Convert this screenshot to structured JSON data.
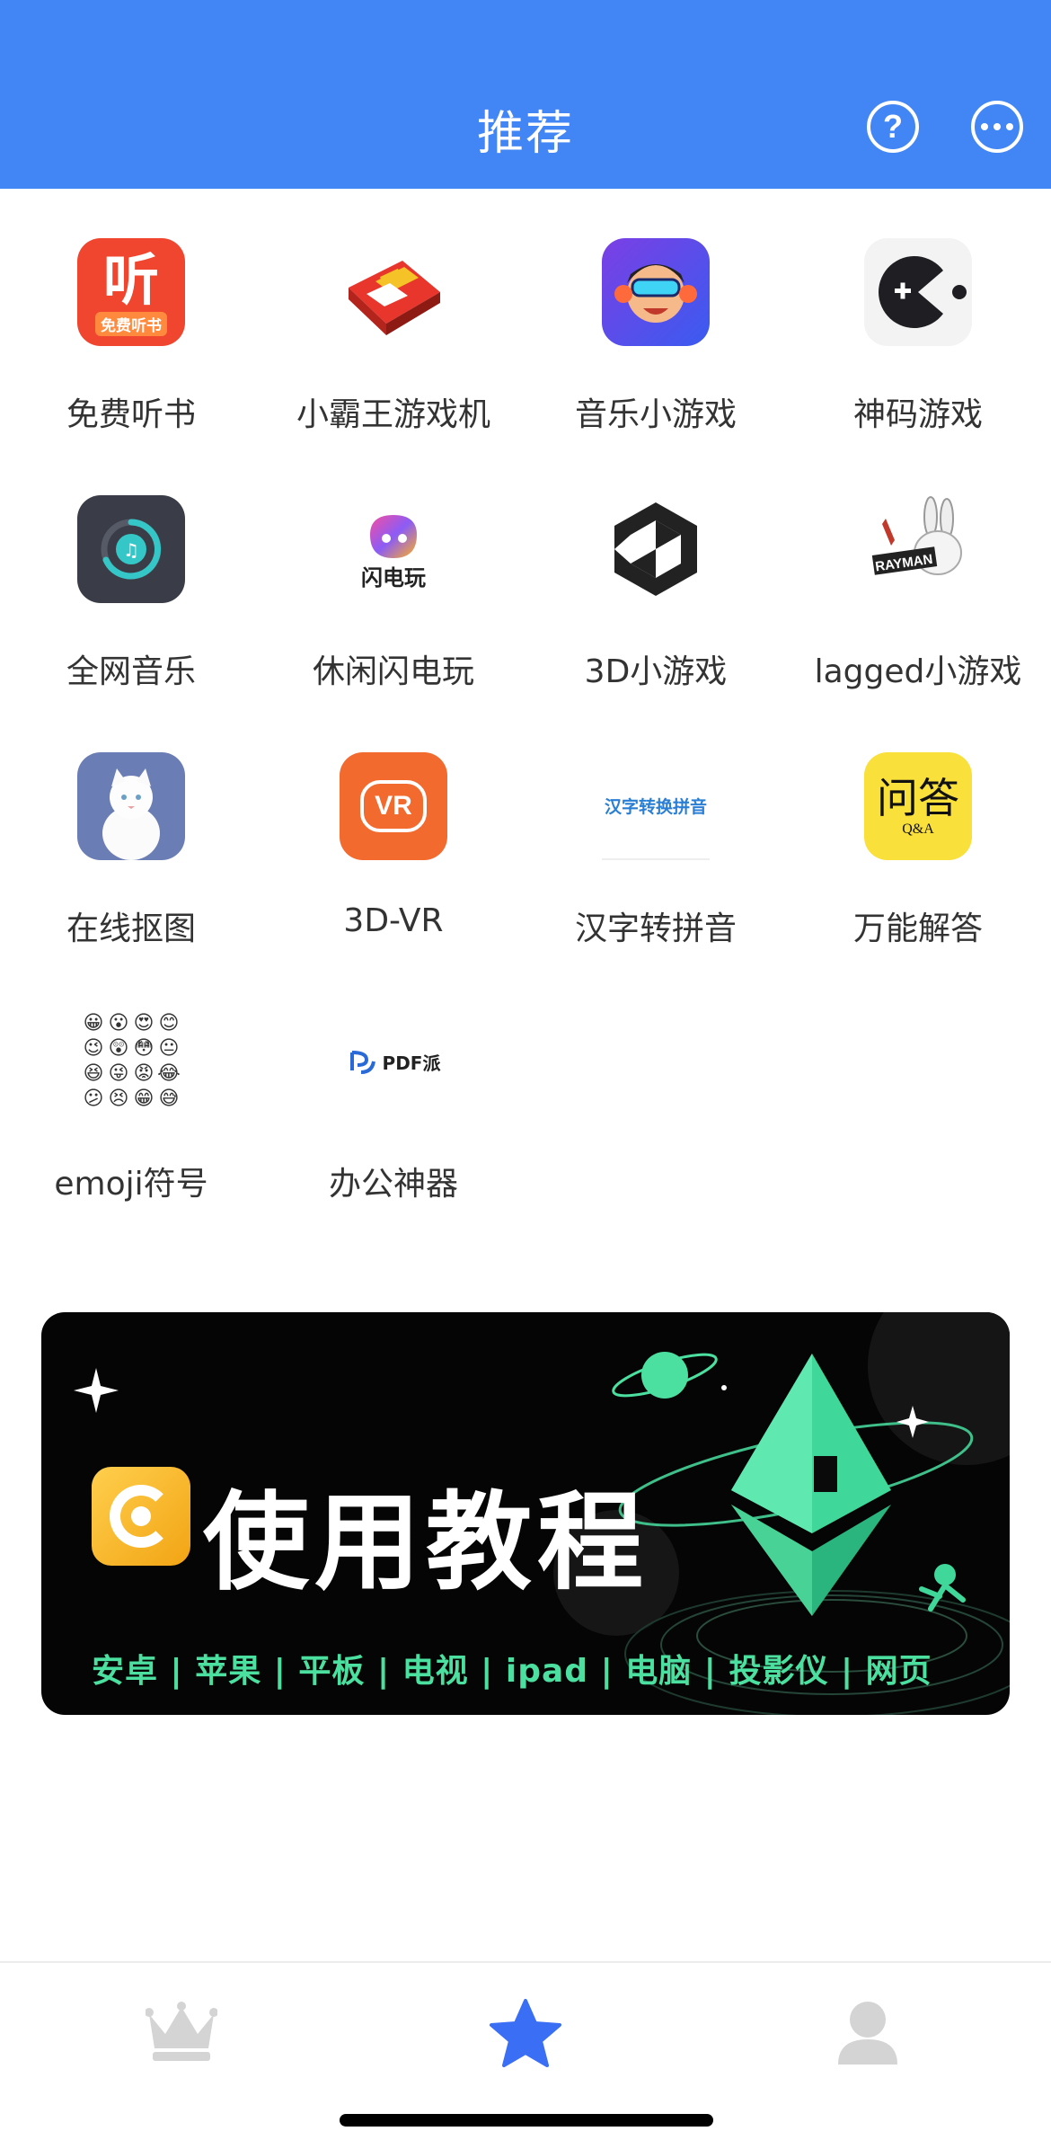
{
  "header": {
    "title": "推荐",
    "help_icon": "question-circle-icon",
    "chat_icon": "chat-bubble-icon",
    "background": "#4285f4"
  },
  "apps": [
    {
      "label": "免费听书",
      "icon": "listen-book-icon",
      "icon_text": "听",
      "icon_subtext": "免费听书"
    },
    {
      "label": "小霸王游戏机",
      "icon": "game-console-icon"
    },
    {
      "label": "音乐小游戏",
      "icon": "music-game-icon"
    },
    {
      "label": "神码游戏",
      "icon": "pacman-icon"
    },
    {
      "label": "全网音乐",
      "icon": "music-player-icon"
    },
    {
      "label": "休闲闪电玩",
      "icon": "flash-play-icon",
      "icon_text": "闪电玩"
    },
    {
      "label": "3D小游戏",
      "icon": "unity-icon"
    },
    {
      "label": "lagged小游戏",
      "icon": "rabbid-icon"
    },
    {
      "label": "在线抠图",
      "icon": "cat-photo-icon"
    },
    {
      "label": "3D-VR",
      "icon": "vr-icon",
      "icon_text": "VR"
    },
    {
      "label": "汉字转拼音",
      "icon": "pinyin-icon",
      "icon_text": "汉字转换拼音"
    },
    {
      "label": "万能解答",
      "icon": "qa-icon",
      "icon_text": "问答",
      "icon_subtext": "Q&A"
    },
    {
      "label": "emoji符号",
      "icon": "emoji-grid-icon"
    },
    {
      "label": "办公神器",
      "icon": "pdf-icon",
      "icon_text": "PDF派"
    }
  ],
  "banner": {
    "title": "使用教程",
    "subtitle": "安卓 | 苹果 | 平板 | 电视 | ipad | 电脑  | 投影仪 | 网页",
    "accent": "#4ce0a0"
  },
  "tabbar": {
    "items": [
      {
        "icon": "crown-icon",
        "active": false
      },
      {
        "icon": "star-icon",
        "active": true
      },
      {
        "icon": "person-icon",
        "active": false
      }
    ],
    "active_color": "#3a6ef5",
    "inactive_color": "#d4d4d4"
  }
}
